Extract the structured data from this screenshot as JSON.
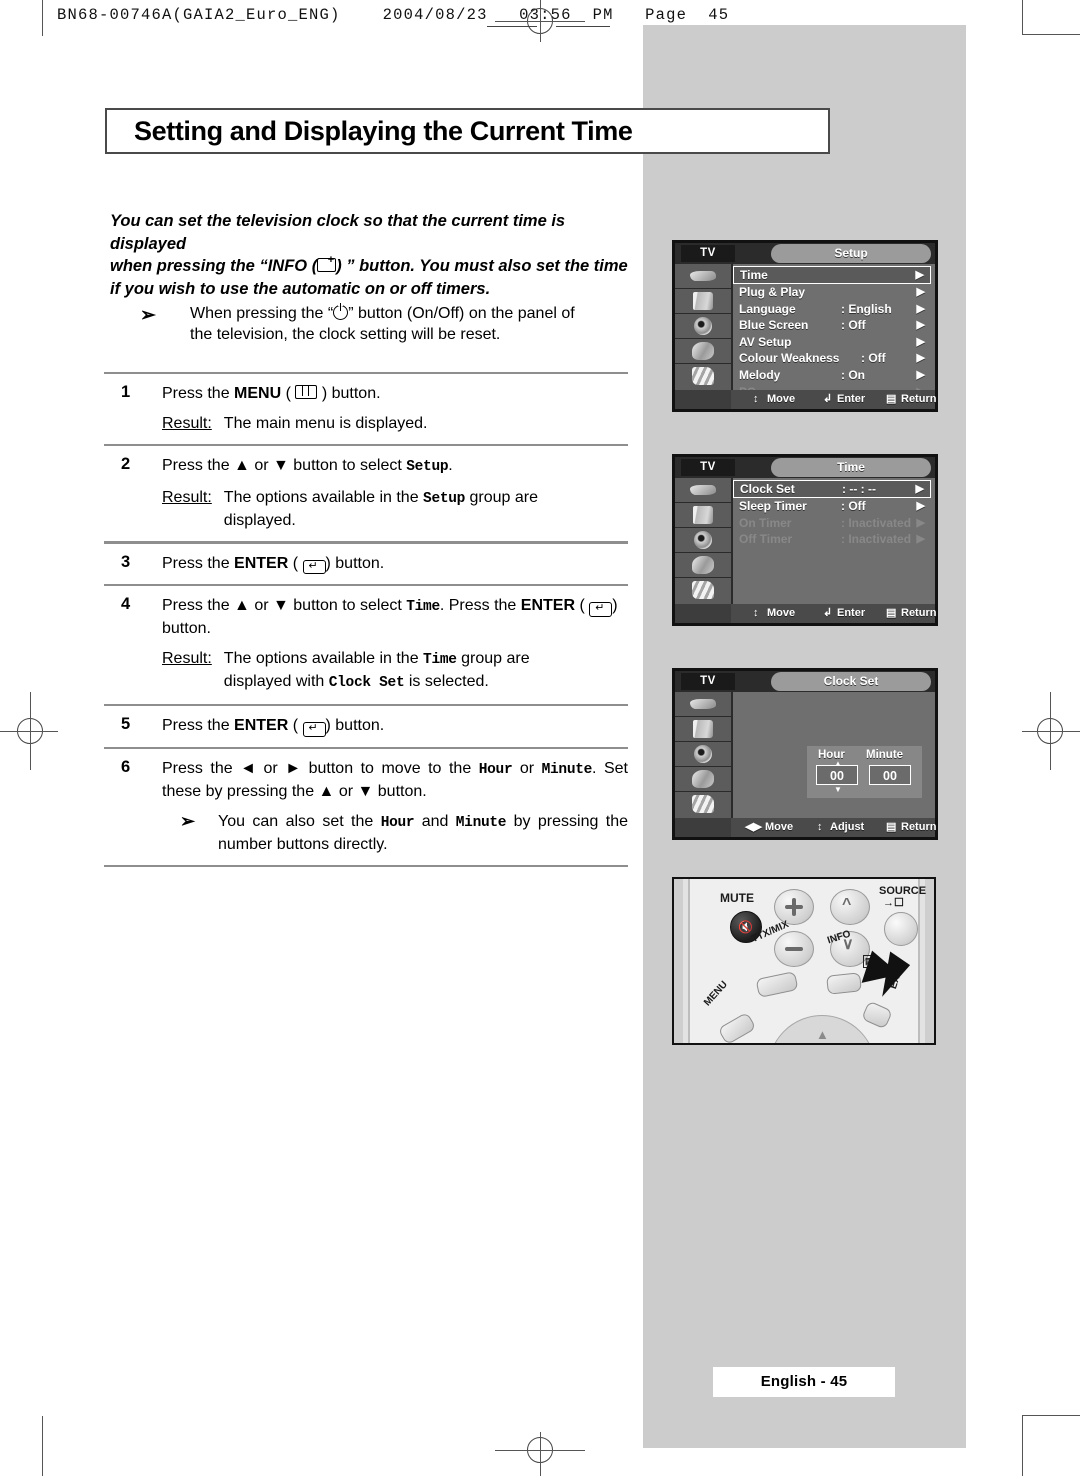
{
  "header": {
    "job_code": "BN68-00746A(GAIA2_Euro_ENG)",
    "date": "2004/08/23",
    "time": "03:56",
    "meridiem": "PM",
    "page_label": "Page",
    "page_number": "45"
  },
  "page_title": "Setting and Displaying the Current Time",
  "intro": {
    "line1": "You can set the television clock so that the current time is displayed",
    "line2_a": "when pressing the “INFO (",
    "line2_b": ") ” button. You must also set the time",
    "line3": "if you wish to use the automatic on or off timers.",
    "info_icon": "info-button-icon"
  },
  "note": {
    "bullet": "➢",
    "text_a": "When pressing the “",
    "text_b": "” button (On/Off) on the panel of",
    "text_c": "the television, the clock setting will be reset.",
    "power_icon": "power-button-icon"
  },
  "steps": [
    {
      "num": "1",
      "text_a": "Press the ",
      "bold": "MENU",
      "text_b": " (",
      "icon": "menu-button-icon",
      "text_c": ") button.",
      "result_label": "Result:",
      "result_text": "The main menu is displayed."
    },
    {
      "num": "2",
      "text_a": "Press the ▲ or ▼ button to select ",
      "mono": "Setup",
      "text_b": ".",
      "result_label": "Result:",
      "result_a": "The options available in the ",
      "result_mono": "Setup",
      "result_b": " group are displayed."
    },
    {
      "num": "3",
      "text_a": "Press the ",
      "bold": "ENTER",
      "text_b": " (",
      "icon": "enter-button-icon",
      "text_c": ") button."
    },
    {
      "num": "4",
      "text_a": "Press the ▲ or ▼ button to select ",
      "mono": "Time",
      "text_b": ". Press the ",
      "bold": "ENTER",
      "text_c": " (",
      "icon": "enter-button-icon",
      "text_d": ") button.",
      "result_label": "Result:",
      "result_a": "The options available in the ",
      "result_mono": "Time",
      "result_b": " group are displayed with ",
      "result_mono2": "Clock Set",
      "result_c": " is selected."
    },
    {
      "num": "5",
      "text_a": "Press the ",
      "bold": "ENTER",
      "text_b": " (",
      "icon": "enter-button-icon",
      "text_c": ") button."
    },
    {
      "num": "6",
      "text_a": "Press the ◄ or ► button to move to the ",
      "mono": "Hour",
      "text_b": " or ",
      "mono2": "Minute",
      "text_c": ". Set these by pressing the ▲ or ▼ button.",
      "subnote_bullet": "➢",
      "sub_a": "You can also set the ",
      "sub_mono": "Hour",
      "sub_b": " and ",
      "sub_mono2": "Minute",
      "sub_c": " by pressing the number buttons directly."
    }
  ],
  "osd_menus": [
    {
      "name": "setup-menu",
      "tv_tag": "TV",
      "title": "Setup",
      "rows": [
        {
          "label": "Time",
          "value": "",
          "selected": true,
          "dim": false,
          "arrow": "▶"
        },
        {
          "label": "Plug & Play",
          "value": "",
          "selected": false,
          "dim": false,
          "arrow": "▶"
        },
        {
          "label": "Language",
          "value": ": English",
          "selected": false,
          "dim": false,
          "arrow": "▶"
        },
        {
          "label": "Blue Screen",
          "value": ": Off",
          "selected": false,
          "dim": false,
          "arrow": "▶"
        },
        {
          "label": "AV Setup",
          "value": "",
          "selected": false,
          "dim": false,
          "arrow": "▶"
        },
        {
          "label": "Colour Weakness",
          "value": ": Off",
          "selected": false,
          "dim": false,
          "arrow": "▶"
        },
        {
          "label": "Melody",
          "value": ": On",
          "selected": false,
          "dim": false,
          "arrow": "▶"
        },
        {
          "label": "PC",
          "value": "",
          "selected": false,
          "dim": true,
          "arrow": "▶"
        }
      ],
      "legend": [
        {
          "icon": "↕",
          "text": "Move"
        },
        {
          "icon": "↲",
          "text": "Enter"
        },
        {
          "icon": "▤",
          "text": "Return"
        }
      ]
    },
    {
      "name": "time-menu",
      "tv_tag": "TV",
      "title": "Time",
      "rows": [
        {
          "label": "Clock Set",
          "value": ": -- : --",
          "selected": true,
          "dim": false,
          "arrow": "▶"
        },
        {
          "label": "Sleep Timer",
          "value": ": Off",
          "selected": false,
          "dim": false,
          "arrow": "▶"
        },
        {
          "label": "On Timer",
          "value": ": Inactivated",
          "selected": false,
          "dim": true,
          "arrow": "▶"
        },
        {
          "label": "Off Timer",
          "value": ": Inactivated",
          "selected": false,
          "dim": true,
          "arrow": "▶"
        }
      ],
      "legend": [
        {
          "icon": "↕",
          "text": "Move"
        },
        {
          "icon": "↲",
          "text": "Enter"
        },
        {
          "icon": "▤",
          "text": "Return"
        }
      ]
    },
    {
      "name": "clock-set-menu",
      "tv_tag": "TV",
      "title": "Clock Set",
      "hour_label": "Hour",
      "minute_label": "Minute",
      "hour_value": "00",
      "minute_value": "00",
      "legend": [
        {
          "icon": "◀▶",
          "text": "Move"
        },
        {
          "icon": "↕",
          "text": "Adjust"
        },
        {
          "icon": "▤",
          "text": "Return"
        }
      ]
    }
  ],
  "remote": {
    "mute_label": "MUTE",
    "source_label": "SOURCE",
    "menu_label": "MENU",
    "ttxmix_label": "TTX/MIX",
    "info_label": "INFO",
    "exit_label": "EXIT"
  },
  "footer": {
    "text": "English - 45"
  },
  "colors": {
    "grey_panel": "#cccccc",
    "osd_body": "#6f6f6f",
    "osd_title_pill": "#9b9b9b",
    "rule": "#8e8e8e"
  }
}
